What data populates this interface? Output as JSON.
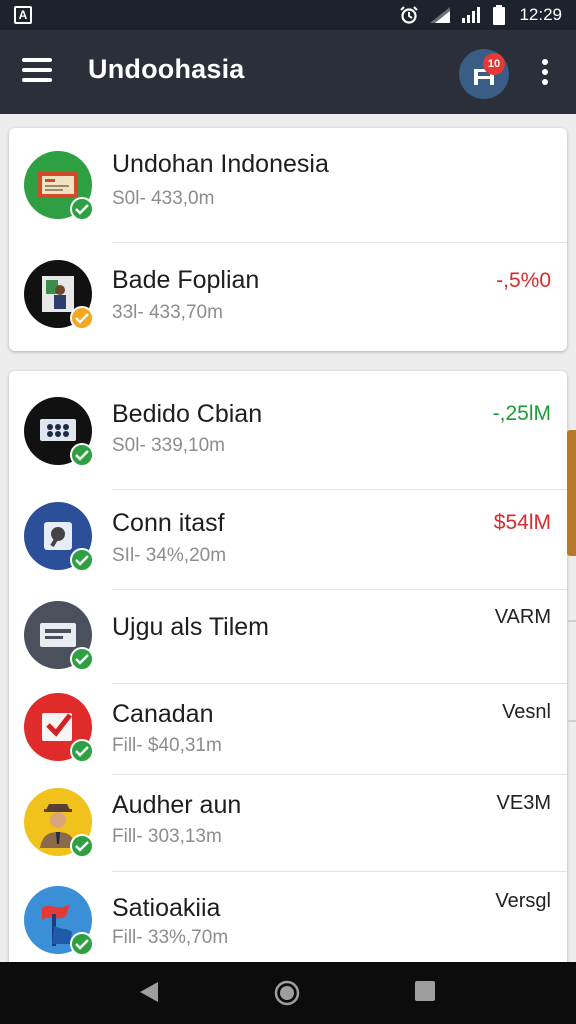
{
  "status_bar": {
    "time": "12:29",
    "left_icon": "A"
  },
  "app_bar": {
    "title": "Undoohasia",
    "cart_badge": "10"
  },
  "groups": [
    {
      "rows": [
        {
          "title": "Undohan Indonesia",
          "subtitle": "S0l- 433,0m",
          "value": "",
          "status": "verified",
          "avatar_icon": "card-icon",
          "avatar_color": "#2ea043"
        },
        {
          "title": "Bade Foplian",
          "subtitle": "33l- 433,70m",
          "value": "-,5%0",
          "value_color": "red",
          "status": "pending",
          "avatar_icon": "portrait-icon",
          "avatar_color": "#111111"
        }
      ]
    },
    {
      "rows": [
        {
          "title": "Bedido Cbian",
          "subtitle": "S0l- 339,10m",
          "value": "-,25lM",
          "value_color": "green",
          "status": "verified",
          "avatar_icon": "dots-icon",
          "avatar_color": "#111111"
        },
        {
          "title": "Conn itasf",
          "subtitle": "SIl- 34%,20m",
          "value": "$54lM",
          "value_color": "red",
          "status": "verified",
          "avatar_icon": "tool-icon",
          "avatar_color": "#2b4f99"
        },
        {
          "title": "Ujgu als Tilem",
          "subtitle": "",
          "value": "VARM",
          "value_color": "dark",
          "status": "verified",
          "avatar_icon": "screen-icon",
          "avatar_color": "#4a505c"
        },
        {
          "title": "Canadan",
          "subtitle": "Fill- $40,31m",
          "value": "Vesnl",
          "value_color": "dark",
          "status": "verified",
          "avatar_icon": "check-box-icon",
          "avatar_color": "#e02b2b"
        },
        {
          "title": "Audher aun",
          "subtitle": "Fill- 303,13m",
          "value": "VE3M",
          "value_color": "dark",
          "status": "verified",
          "avatar_icon": "person-icon",
          "avatar_color": "#f1c21b"
        },
        {
          "title": "Satioakiia",
          "subtitle": "Fill- 33%,70m",
          "value": "Versgl",
          "value_color": "dark",
          "status": "verified",
          "avatar_icon": "flag-icon",
          "avatar_color": "#3a8fd6"
        }
      ]
    }
  ]
}
